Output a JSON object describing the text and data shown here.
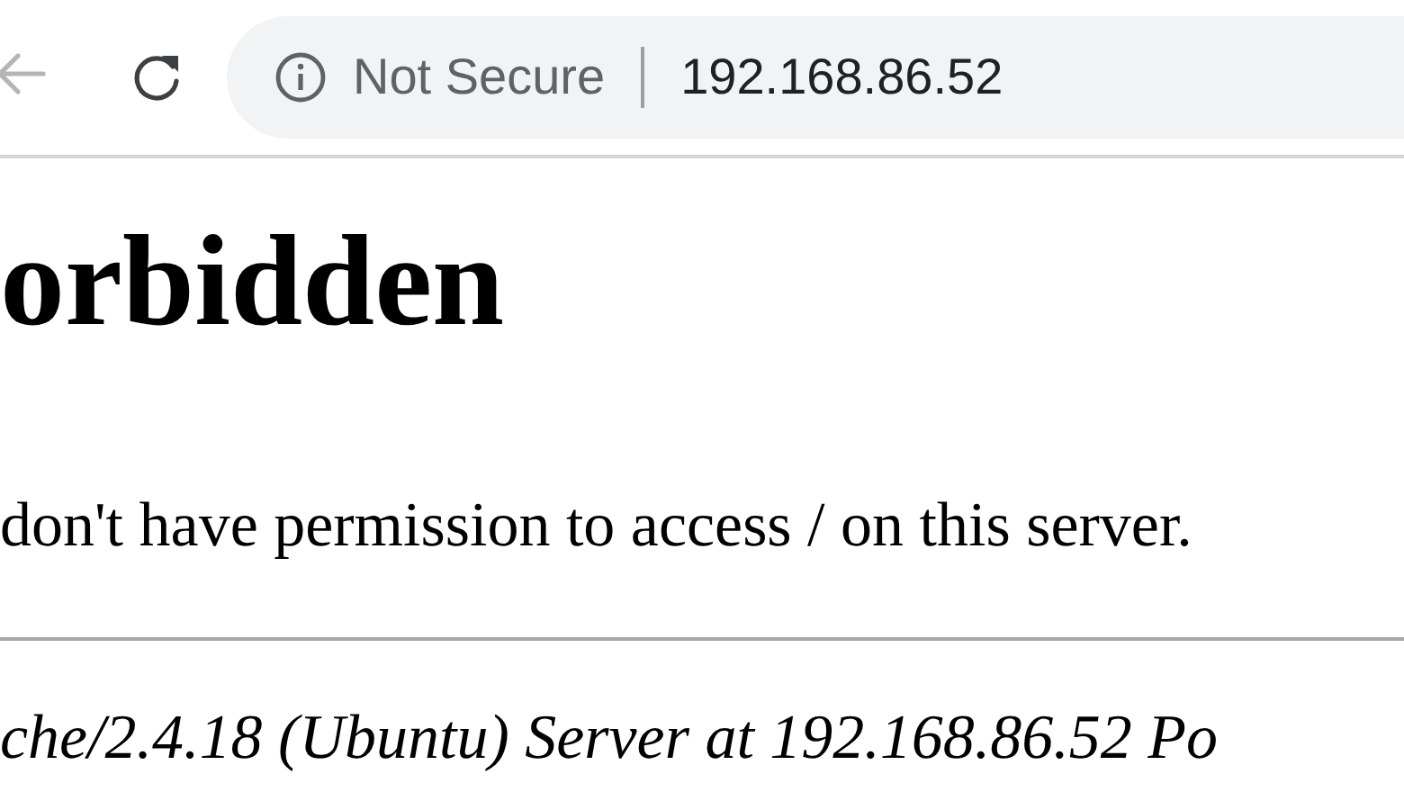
{
  "toolbar": {
    "buttons": [
      {
        "kind": "back",
        "disabled": true
      },
      {
        "kind": "reload",
        "disabled": false
      }
    ],
    "address_bar": {
      "security": "Not Secure",
      "url": "192.168.86.52"
    }
  },
  "page": {
    "heading": "orbidden",
    "message": "don't have permission to access / on this server.",
    "address": "che/2.4.18 (Ubuntu) Server at 192.168.86.52 Po"
  }
}
